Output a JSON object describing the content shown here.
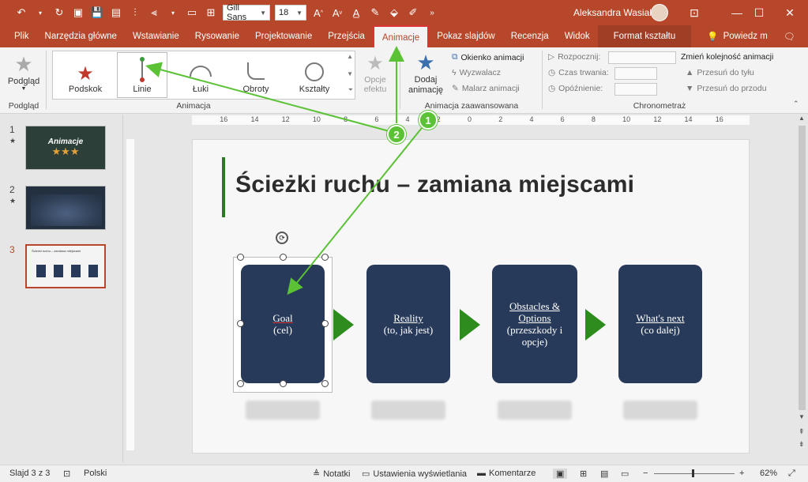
{
  "titlebar": {
    "font_name": "Gill Sans",
    "font_size": "18",
    "user_name": "Aleksandra Wasiak"
  },
  "tabs": [
    {
      "label": "Plik",
      "active": false
    },
    {
      "label": "Narzędzia główne",
      "active": false
    },
    {
      "label": "Wstawianie",
      "active": false
    },
    {
      "label": "Rysowanie",
      "active": false
    },
    {
      "label": "Projektowanie",
      "active": false
    },
    {
      "label": "Przejścia",
      "active": false
    },
    {
      "label": "Animacje",
      "active": true
    },
    {
      "label": "Pokaz slajdów",
      "active": false
    },
    {
      "label": "Recenzja",
      "active": false
    },
    {
      "label": "Widok",
      "active": false
    },
    {
      "label": "Format kształtu",
      "active": false
    },
    {
      "label": "Powiedz m",
      "active": false
    }
  ],
  "ribbon": {
    "preview_label": "Podgląd",
    "preview_group": "Podgląd",
    "gallery": [
      "Podskok",
      "Linie",
      "Łuki",
      "Obroty",
      "Kształty"
    ],
    "effect_options": "Opcje efektu",
    "animation_group": "Animacja",
    "add_animation": "Dodaj animację",
    "animation_pane": "Okienko animacji",
    "trigger": "Wyzwalacz",
    "painter": "Malarz animacji",
    "advanced_group": "Animacja zaawansowana",
    "start": "Rozpocznij:",
    "duration": "Czas trwania:",
    "delay": "Opóźnienie:",
    "reorder": "Zmień kolejność animacji",
    "move_earlier": "Przesuń do tyłu",
    "move_later": "Przesuń do przodu",
    "timing_group": "Chronometraż"
  },
  "ruler_labels": [
    "16",
    "14",
    "12",
    "10",
    "8",
    "6",
    "4",
    "2",
    "0",
    "2",
    "4",
    "6",
    "8",
    "10",
    "12",
    "14",
    "16"
  ],
  "slides": [
    {
      "num": "1",
      "star": "★",
      "caption": "Animacje"
    },
    {
      "num": "2",
      "star": "★",
      "caption": ""
    },
    {
      "num": "3",
      "star": "",
      "caption": "Ścieżki ruchu – zamiana miejscami"
    }
  ],
  "slide": {
    "title": "Ścieżki ruchu – zamiana miejscami",
    "cards": [
      {
        "main": "Goal",
        "sub": "(cel)"
      },
      {
        "main": "Reality",
        "sub": "(to, jak jest)"
      },
      {
        "main": "Obstacles & Options",
        "sub": "(przeszkody i opcje)"
      },
      {
        "main": "What's next",
        "sub": "(co dalej)"
      }
    ]
  },
  "callouts": [
    "1",
    "2"
  ],
  "status": {
    "slide_info": "Slajd 3 z 3",
    "language": "Polski",
    "notes": "Notatki",
    "display_settings": "Ustawienia wyświetlania",
    "comments": "Komentarze",
    "zoom": "62%"
  },
  "colors": {
    "brand": "#b7472a",
    "card": "#283a5a",
    "accent_green": "#5bc236",
    "title_bar": "#2a7a1f"
  }
}
